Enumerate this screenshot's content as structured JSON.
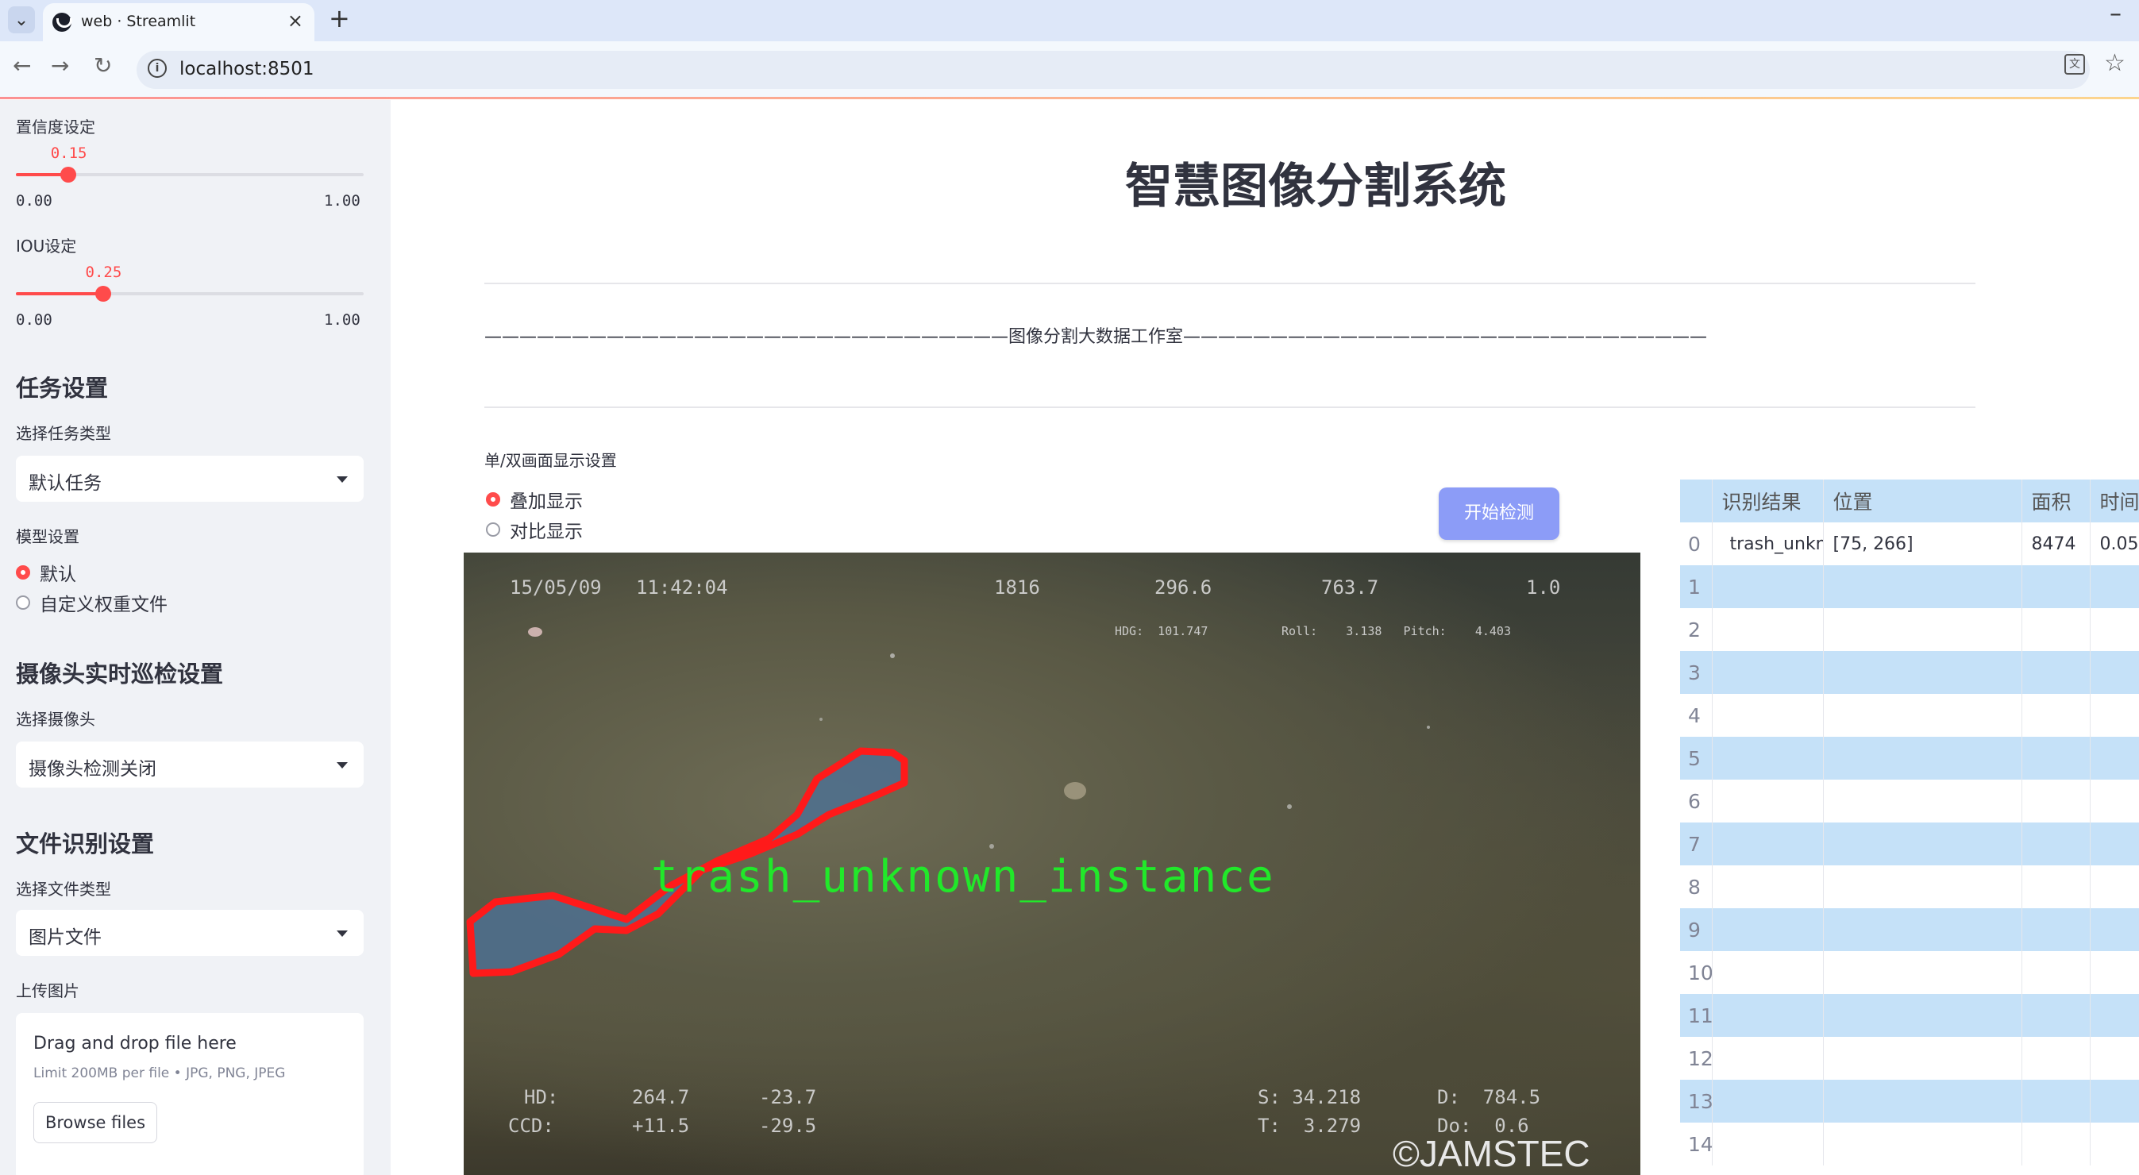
{
  "browser": {
    "tab_title": "web · Streamlit",
    "url": "localhost:8501"
  },
  "sidebar": {
    "confidence": {
      "label": "置信度设定",
      "value": "0.15",
      "value_fraction": 0.15,
      "min": "0.00",
      "max": "1.00"
    },
    "iou": {
      "label": "IOU设定",
      "value": "0.25",
      "value_fraction": 0.25,
      "min": "0.00",
      "max": "1.00"
    },
    "task_header": "任务设置",
    "task_type_label": "选择任务类型",
    "task_type_value": "默认任务",
    "model_label": "模型设置",
    "model_options": [
      "默认",
      "自定义权重文件"
    ],
    "model_selected": 0,
    "camera_header": "摄像头实时巡检设置",
    "camera_label": "选择摄像头",
    "camera_value": "摄像头检测关闭",
    "file_header": "文件识别设置",
    "file_type_label": "选择文件类型",
    "file_type_value": "图片文件",
    "upload_label": "上传图片",
    "upload_title": "Drag and drop file here",
    "upload_hint": "Limit 200MB per file • JPG, PNG, JPEG",
    "browse_label": "Browse files"
  },
  "main": {
    "title": "智慧图像分割系统",
    "divider_text": "——————————————————————————————图像分割大数据工作室——————————————————————————————",
    "display_label": "单/双画面显示设置",
    "display_options": [
      "叠加显示",
      "对比显示"
    ],
    "display_selected": 0,
    "start_button": "开始检测",
    "image": {
      "osd_top": "15/05/09   11:42:04",
      "osd_1816": "1816",
      "osd_2966": "296.6",
      "osd_7637": "763.7",
      "osd_10": "1.0",
      "osd_hdg": "HDG:  101.747",
      "osd_roll": "Roll:    3.138   Pitch:    4.403",
      "osd_hd": "HD:",
      "osd_hd_v1": "264.7",
      "osd_hd_v2": "-23.7",
      "osd_ccd": "CCD:",
      "osd_ccd_v1": "+11.5",
      "osd_ccd_v2": "-29.5",
      "osd_s": "S: 34.218",
      "osd_t": "T:  3.279",
      "osd_d": "D:  784.5",
      "osd_do": "Do:  0.6",
      "detection_label": "trash_unknown_instance",
      "watermark": "©JAMSTEC"
    },
    "table": {
      "headers": [
        "",
        "识别结果",
        "位置",
        "面积",
        "时间"
      ],
      "rows": [
        {
          "idx": "0",
          "result": "trash_unknown_instance",
          "position": "[75, 266]",
          "area": "8474",
          "time": "0.05"
        },
        {
          "idx": "1"
        },
        {
          "idx": "2"
        },
        {
          "idx": "3"
        },
        {
          "idx": "4"
        },
        {
          "idx": "5"
        },
        {
          "idx": "6"
        },
        {
          "idx": "7"
        },
        {
          "idx": "8"
        },
        {
          "idx": "9"
        },
        {
          "idx": "10"
        },
        {
          "idx": "11"
        },
        {
          "idx": "12"
        },
        {
          "idx": "13"
        },
        {
          "idx": "14"
        }
      ]
    }
  },
  "colors": {
    "accent": "#ff4b4b",
    "sidebar_bg": "#f0f2f6",
    "button_bg": "#8c9cf7",
    "table_stripe": "#c5e1f8",
    "mask_outline": "#ff1a1a",
    "label_green": "#21e82a"
  }
}
